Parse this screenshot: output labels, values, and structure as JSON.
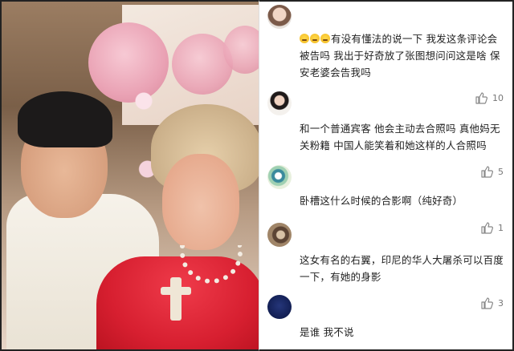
{
  "comments": [
    {
      "text_before_emoji": "",
      "text": "有没有懂法的说一下 我发这条评论会被告吗 我出于好奇放了张图想问问这是啥 保安老婆会告我吗",
      "emoji_count": 3,
      "likes": "10",
      "avatar_style": "girl-photo"
    },
    {
      "text": "和一个普通宾客 他会主动去合照吗 真他妈无关粉籍 中国人能笑着和她这样的人合照吗",
      "likes": "5",
      "avatar_style": "girl-black-dress"
    },
    {
      "text": "卧槽这什么时候的合影啊（纯好奇）",
      "likes": "1",
      "avatar_style": "cartoon-green"
    },
    {
      "text": "这女有名的右翼，印尼的华人大屠杀可以百度一下，有她的身影",
      "likes": "3",
      "avatar_style": "brown-photo"
    },
    {
      "text": "是谁 我不说",
      "likes": "",
      "avatar_style": "blue-circle"
    }
  ],
  "colors": {
    "dress": "#d71f30",
    "like_icon": "#888888",
    "text": "#222222"
  }
}
